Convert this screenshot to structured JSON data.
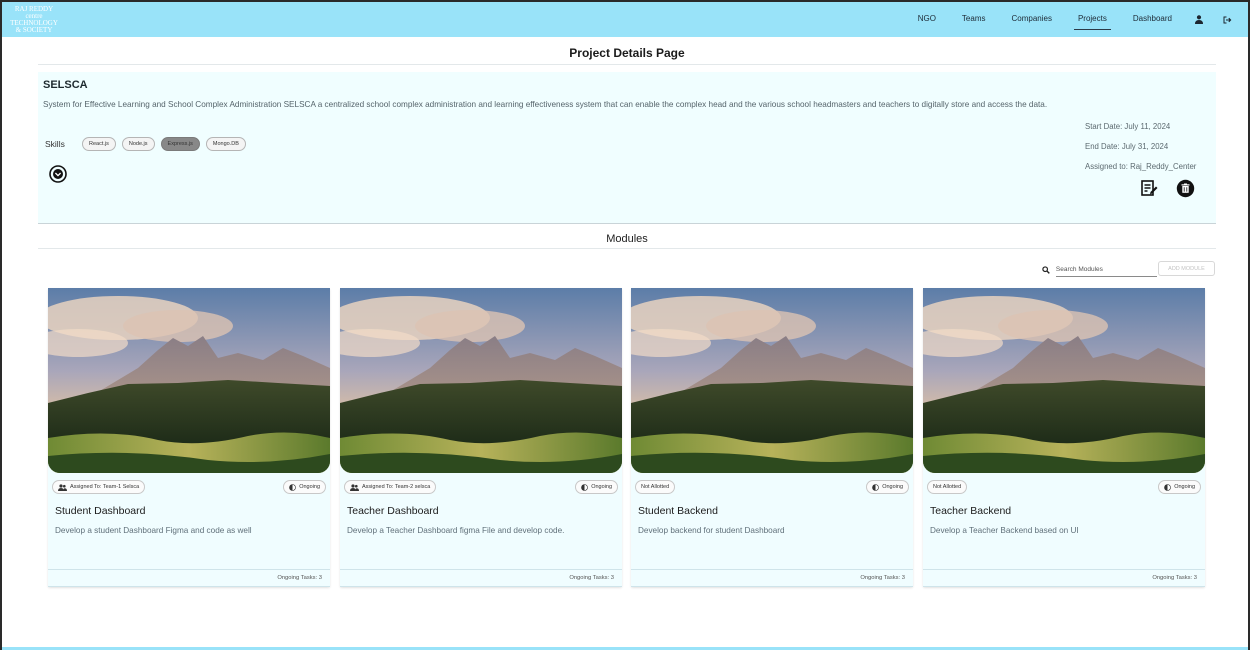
{
  "brand": {
    "logo_lines": [
      "RAJ REDDY centre",
      "TECHNOLOGY",
      "& SOCIETY"
    ]
  },
  "nav": {
    "items": [
      "NGO",
      "Teams",
      "Companies",
      "Projects",
      "Dashboard"
    ],
    "active": "Projects",
    "icons": [
      "person-icon",
      "logout-icon"
    ]
  },
  "page": {
    "title": "Project Details Page"
  },
  "project": {
    "name": "SELSCA",
    "description": "System for Effective Learning and School Complex Administration SELSCA a centralized school complex administration and learning effectiveness system that can enable the complex head and the various school headmasters and teachers to digitally store and access the data.",
    "skills_label": "Skills",
    "skills": [
      "React.js",
      "Node.js",
      "Express.js",
      "Mongo.DB"
    ],
    "selected_skill": "Express.js",
    "start_date": "Start Date: July 11, 2024",
    "end_date": "End Date: July 31, 2024",
    "assigned_to": "Assigned to: Raj_Reddy_Center"
  },
  "modules": {
    "title": "Modules",
    "search_placeholder": "Search Modules",
    "add_label": "ADD MODULE",
    "cards": [
      {
        "assignment": "Assigned To: Team-1 Selsca",
        "status": "Ongoing",
        "title": "Student Dashboard",
        "description": "Develop a student Dashboard Figma and code as well",
        "footer": "Ongoing Tasks: 3"
      },
      {
        "assignment": "Assigned To: Team-2 selsca",
        "status": "Ongoing",
        "title": "Teacher Dashboard",
        "description": "Develop a Teacher Dashboard figma File and develop code.",
        "footer": "Ongoing Tasks: 3"
      },
      {
        "assignment": "Not Allotted",
        "status": "Ongoing",
        "title": "Student Backend",
        "description": "Develop backend for student Dashboard",
        "footer": "Ongoing Tasks: 3"
      },
      {
        "assignment": "Not Allotted",
        "status": "Ongoing",
        "title": "Teacher Backend",
        "description": "Develop a Teacher Backend based on UI",
        "footer": "Ongoing Tasks: 3"
      }
    ]
  },
  "colors": {
    "navbar": "#99e3f9",
    "panel": "#f0feff",
    "selected_chip": "#888888"
  }
}
